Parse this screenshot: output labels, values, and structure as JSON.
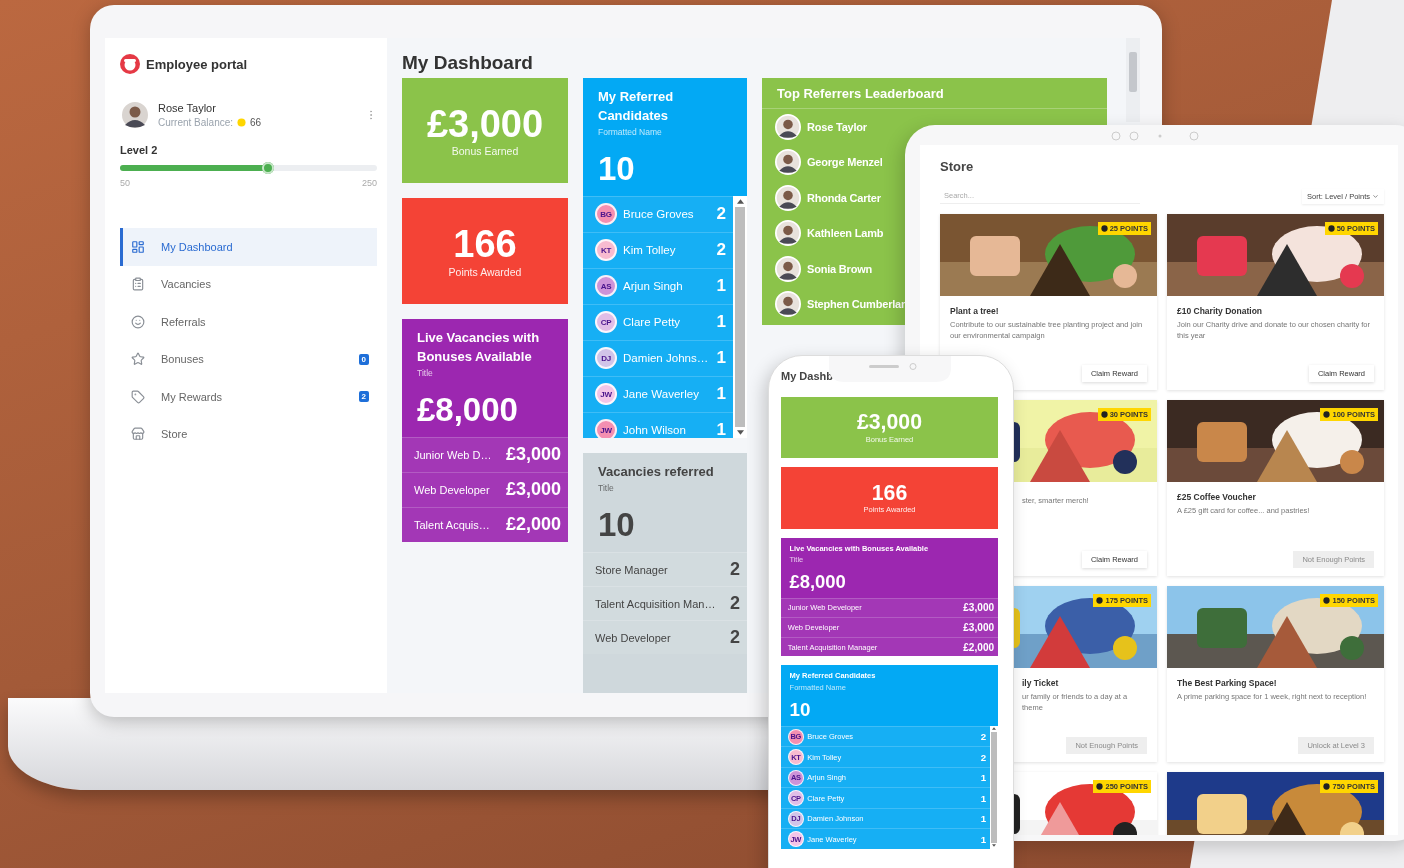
{
  "laptop": {
    "sidebar": {
      "app_title": "Employee portal",
      "user": {
        "name": "Rose Taylor",
        "balance_label": "Current Balance:",
        "balance": "66"
      },
      "level": {
        "label": "Level 2",
        "level": 0.6,
        "min": "50",
        "max": "250"
      },
      "nav": [
        {
          "label": "My Dashboard",
          "selected": true
        },
        {
          "label": "Vacancies",
          "selected": false
        },
        {
          "label": "Referrals",
          "selected": false
        },
        {
          "label": "Bonuses",
          "selected": false,
          "badge": "0"
        },
        {
          "label": "My Rewards",
          "selected": false,
          "badge": "2"
        },
        {
          "label": "Store",
          "selected": false
        }
      ]
    },
    "page_title": "My Dashboard",
    "bonus_card": {
      "value": "£3,000",
      "label": "Bonus Earned"
    },
    "points_card": {
      "value": "166",
      "label": "Points Awarded"
    },
    "vacancies_card": {
      "title": "Live Vacancies with Bonuses Available",
      "subtitle": "Title",
      "value": "£8,000",
      "rows": [
        {
          "name": "Junior Web D…",
          "amount": "£3,000"
        },
        {
          "name": "Web Developer",
          "amount": "£3,000"
        },
        {
          "name": "Talent Acquis…",
          "amount": "£2,000"
        }
      ]
    },
    "candidates_card": {
      "title": "My Referred Candidates",
      "subtitle": "Formatted Name",
      "value": "10",
      "rows": [
        {
          "initials": "BG",
          "name": "Bruce Groves",
          "count": "2"
        },
        {
          "initials": "KT",
          "name": "Kim Tolley",
          "count": "2"
        },
        {
          "initials": "AS",
          "name": "Arjun Singh",
          "count": "1"
        },
        {
          "initials": "CP",
          "name": "Clare Petty",
          "count": "1"
        },
        {
          "initials": "DJ",
          "name": "Damien Johns…",
          "count": "1"
        },
        {
          "initials": "JW",
          "name": "Jane Waverley",
          "count": "1"
        },
        {
          "initials": "JW",
          "name": "John Wilson",
          "count": "1"
        }
      ]
    },
    "referred_card": {
      "title": "Vacancies referred",
      "subtitle": "Title",
      "value": "10",
      "rows": [
        {
          "name": "Store Manager",
          "count": "2"
        },
        {
          "name": "Talent Acquisition Man…",
          "count": "2"
        },
        {
          "name": "Web Developer",
          "count": "2"
        }
      ]
    },
    "leaderboard": {
      "title": "Top Referrers Leaderboard",
      "people": [
        "Rose Taylor",
        "George Menzel",
        "Rhonda Carter",
        "Kathleen Lamb",
        "Sonia Brown",
        "Stephen Cumberlan"
      ]
    }
  },
  "tablet": {
    "title": "Store",
    "search": {
      "placeholder": "Search..."
    },
    "sort": "Sort: Level / Points",
    "items": [
      {
        "title": "Plant a tree!",
        "description": "Contribute to our sustainable tree planting project and join our environmental campaign",
        "button": "Claim Reward",
        "disabled": false,
        "points": "25 POINTS"
      },
      {
        "title": "£10 Charity Donation",
        "description": "Join our Charity drive and donate to our chosen charity for this year",
        "button": "Claim Reward",
        "disabled": false,
        "points": "50 POINTS"
      },
      {
        "description": "ster, smarter merch!",
        "button": "Claim Reward",
        "disabled": false,
        "points": "30 POINTS"
      },
      {
        "title": "£25 Coffee Voucher",
        "description": "A £25 gift card for coffee... and pastries!",
        "button": "Not Enough Points",
        "disabled": true,
        "points": "100 POINTS"
      },
      {
        "title": "ily Ticket",
        "description": "ur family or friends to a day at a theme",
        "button": "Not Enough Points",
        "disabled": true,
        "points": "175 POINTS"
      },
      {
        "title": "The Best Parking Space!",
        "description": "A prime parking space for 1 week, right next to reception!",
        "button": "Unlock at Level 3",
        "disabled": true,
        "points": "150 POINTS"
      },
      {
        "points": "250 POINTS"
      },
      {
        "points": "750 POINTS"
      }
    ]
  },
  "phone": {
    "page_title": "My Dashb",
    "bonus_card": {
      "value": "£3,000",
      "label": "Bonus Earned"
    },
    "points_card": {
      "value": "166",
      "label": "Points Awarded"
    },
    "vacancies_card": {
      "title": "Live Vacancies with Bonuses Available",
      "subtitle": "Title",
      "value": "£8,000",
      "rows": [
        {
          "name": "Junior Web Developer",
          "amount": "£3,000"
        },
        {
          "name": "Web Developer",
          "amount": "£3,000"
        },
        {
          "name": "Talent Acquisition Manager",
          "amount": "£2,000"
        }
      ]
    },
    "candidates_card": {
      "title": "My Referred Candidates",
      "subtitle": "Formatted Name",
      "value": "10",
      "rows": [
        {
          "initials": "BG",
          "name": "Bruce Groves",
          "count": "2"
        },
        {
          "initials": "KT",
          "name": "Kim Tolley",
          "count": "2"
        },
        {
          "initials": "AS",
          "name": "Arjun Singh",
          "count": "1"
        },
        {
          "initials": "CP",
          "name": "Clare Petty",
          "count": "1"
        },
        {
          "initials": "DJ",
          "name": "Damien Johnson",
          "count": "1"
        },
        {
          "initials": "JW",
          "name": "Jane Waverley",
          "count": "1"
        }
      ]
    }
  }
}
